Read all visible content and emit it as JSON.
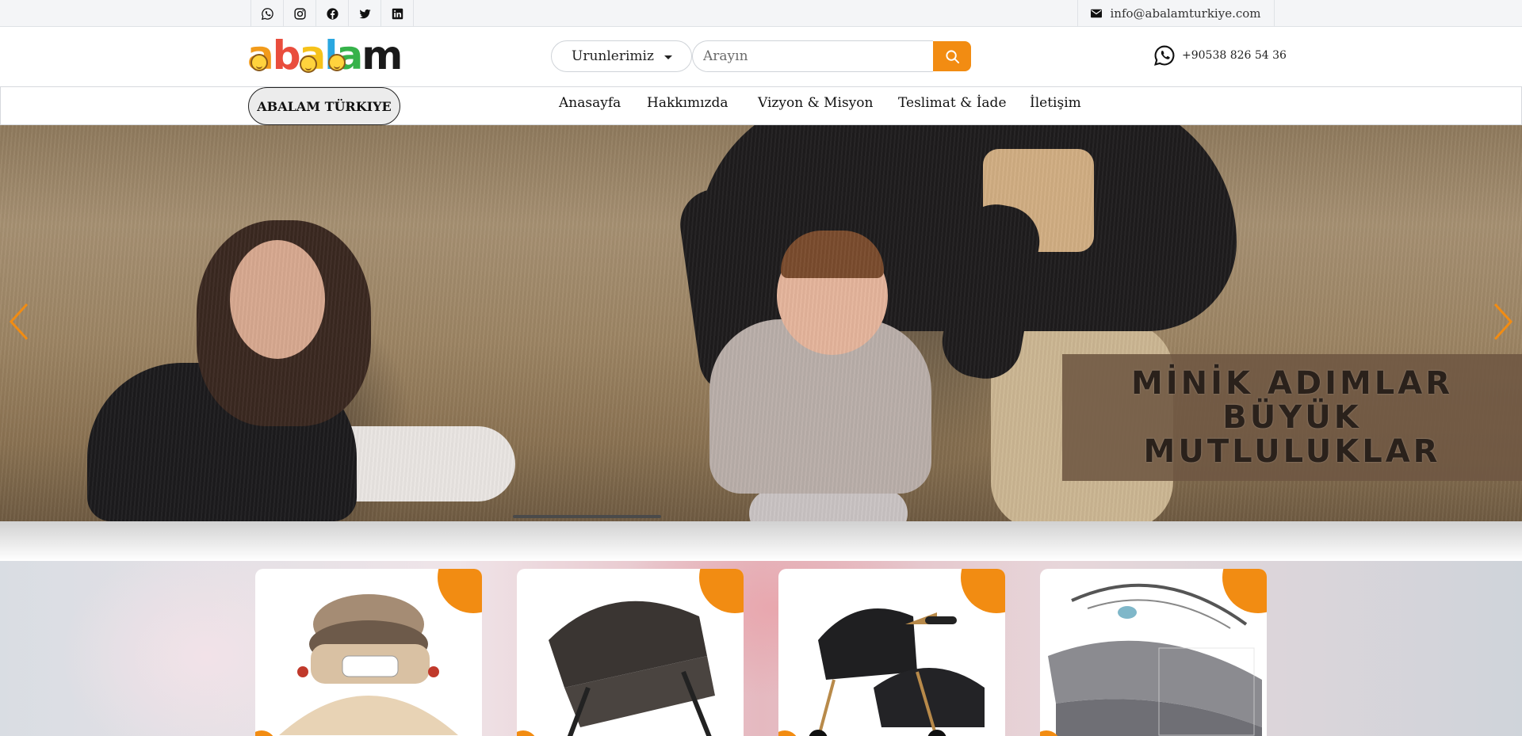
{
  "topbar": {
    "socials": [
      {
        "icon": "whatsapp-icon"
      },
      {
        "icon": "instagram-icon"
      },
      {
        "icon": "facebook-icon"
      },
      {
        "icon": "twitter-icon"
      },
      {
        "icon": "linkedin-icon"
      }
    ],
    "email": "info@abalamturkiye.com"
  },
  "header": {
    "logo_text": "abalam",
    "category_select": "Urunlerimiz",
    "search_placeholder": "Arayın",
    "phone": "+90538 826 54 36"
  },
  "nav": {
    "brand": "ABALAM TÜRKIYE",
    "links": [
      "Anasayfa",
      "Hakkımızda",
      "Vizyon & Misyon",
      "Teslimat & İade",
      "İletişim"
    ]
  },
  "hero": {
    "slogan_lines": [
      "MİNİK ADIMLAR",
      "BÜYÜK",
      "MUTLULUKLAR"
    ]
  },
  "colors": {
    "accent": "#f28c12",
    "topbar_bg": "#f4f5f7"
  },
  "products": [
    {
      "name": "baby-walker"
    },
    {
      "name": "stroller-black"
    },
    {
      "name": "travel-system-gold"
    },
    {
      "name": "baby-bouncer-grey"
    }
  ]
}
